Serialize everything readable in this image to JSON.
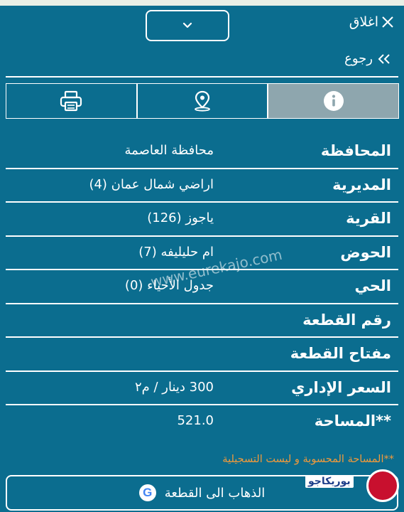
{
  "header": {
    "close_label": "اغلاق"
  },
  "back": {
    "label": "رجوع"
  },
  "tabs": [
    {
      "icon": "info-icon",
      "active": true
    },
    {
      "icon": "location-pin-icon",
      "active": false
    },
    {
      "icon": "printer-icon",
      "active": false
    }
  ],
  "details": [
    {
      "label": "المحافظة",
      "value": "محافظة العاصمة"
    },
    {
      "label": "المديرية",
      "value": "اراضي شمال عمان (4)"
    },
    {
      "label": "القرية",
      "value": "ياجوز (126)"
    },
    {
      "label": "الحوض",
      "value": "ام حليليفه (7)"
    },
    {
      "label": "الحي",
      "value": "جدول الأحياء (0)"
    },
    {
      "label": "رقم القطعة",
      "value": ""
    },
    {
      "label": "مفتاح القطعة",
      "value": ""
    },
    {
      "label": "السعر الإداري",
      "value": "300 دينار / م٢"
    },
    {
      "label": "**المساحة",
      "value": "521.0"
    }
  ],
  "footnote": "**المساحة المحسوبة و ليست التسجيلية",
  "navigate_button": {
    "label": "الذهاب الى القطعة"
  },
  "watermark": "www.eurekajo.com",
  "logo": {
    "text": "بوريكاجو"
  },
  "colors": {
    "background": "#0b6d8f",
    "active_tab": "#8ea6ae",
    "note": "#f29a3b",
    "logo_red": "#c8102e"
  }
}
